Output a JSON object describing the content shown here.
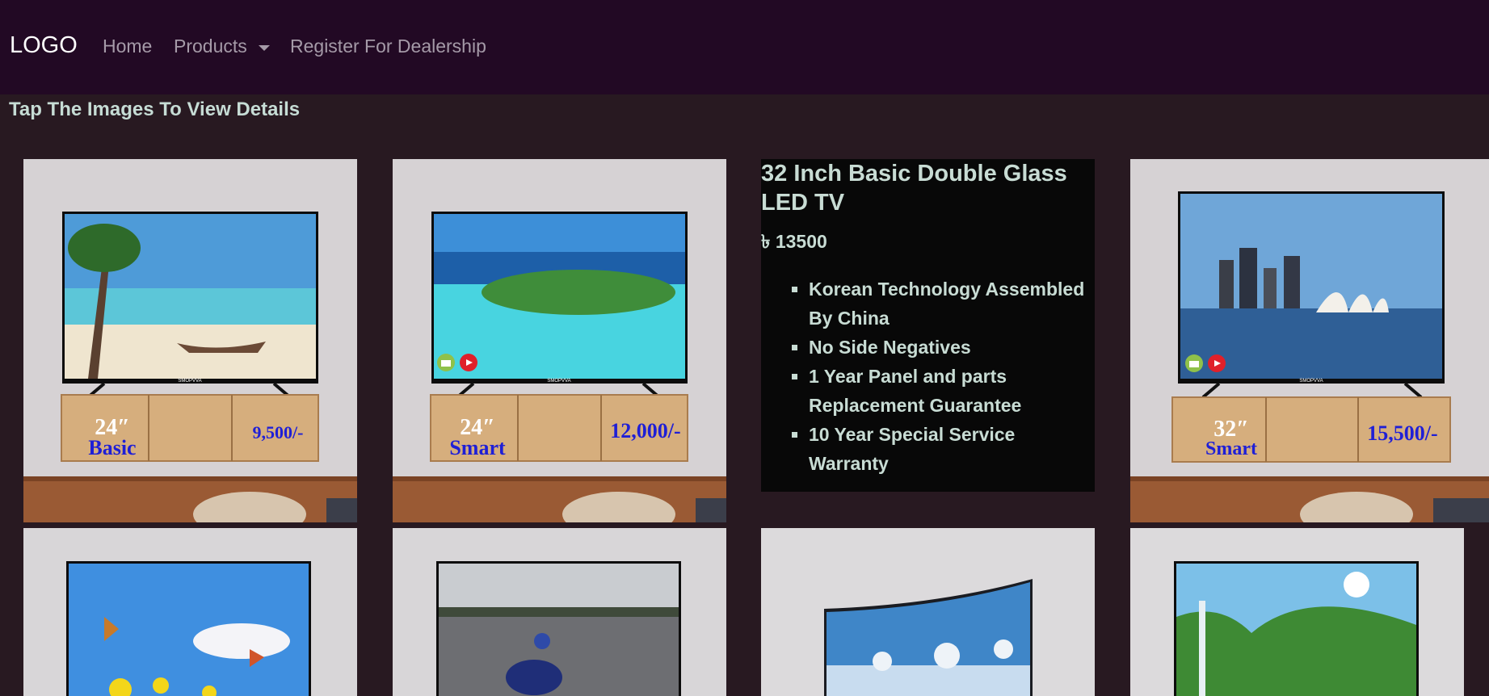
{
  "nav": {
    "logo": "LOGO",
    "links": [
      "Home",
      "Products",
      "Register For Dealership"
    ]
  },
  "hint": "Tap The Images To View Details",
  "detail": {
    "title": "32 Inch Basic Double Glass LED TV",
    "price": "৳ 13500",
    "features": [
      "Korean Technology Assembled By China",
      "No Side Negatives",
      "1 Year Panel and parts Replacement Guarantee",
      "10 Year Special Service Warranty"
    ]
  },
  "products": [
    {
      "size": "24″",
      "type": "Basic",
      "price": "9,500/-",
      "brand": "SMOPVVA",
      "screen": "tropical beach with palm tree and longtail boat"
    },
    {
      "size": "24″",
      "type": "Smart",
      "price": "12,000/-",
      "brand": "SMOPVVA",
      "screen": "turquoise lagoon with island resort"
    },
    {
      "size": "32″",
      "type": "Smart",
      "price": "15,500/-",
      "brand": "SMOPVVA",
      "screen": "city skyline with opera house"
    },
    {
      "screen": "butterflies and yellow flowers"
    },
    {
      "screen": "motorcycle racer on track"
    },
    {
      "screen": "curved TV with snowy winter lake"
    },
    {
      "screen": "green mountains and waterfall"
    }
  ],
  "icons": [
    "android-icon",
    "youtube-icon"
  ],
  "colors": {
    "navbar": "#220924",
    "page": "#281921",
    "hint_text": "#c6dcd5",
    "detail_bg": "#080808",
    "cabinet_text": "#1f1fd6"
  }
}
